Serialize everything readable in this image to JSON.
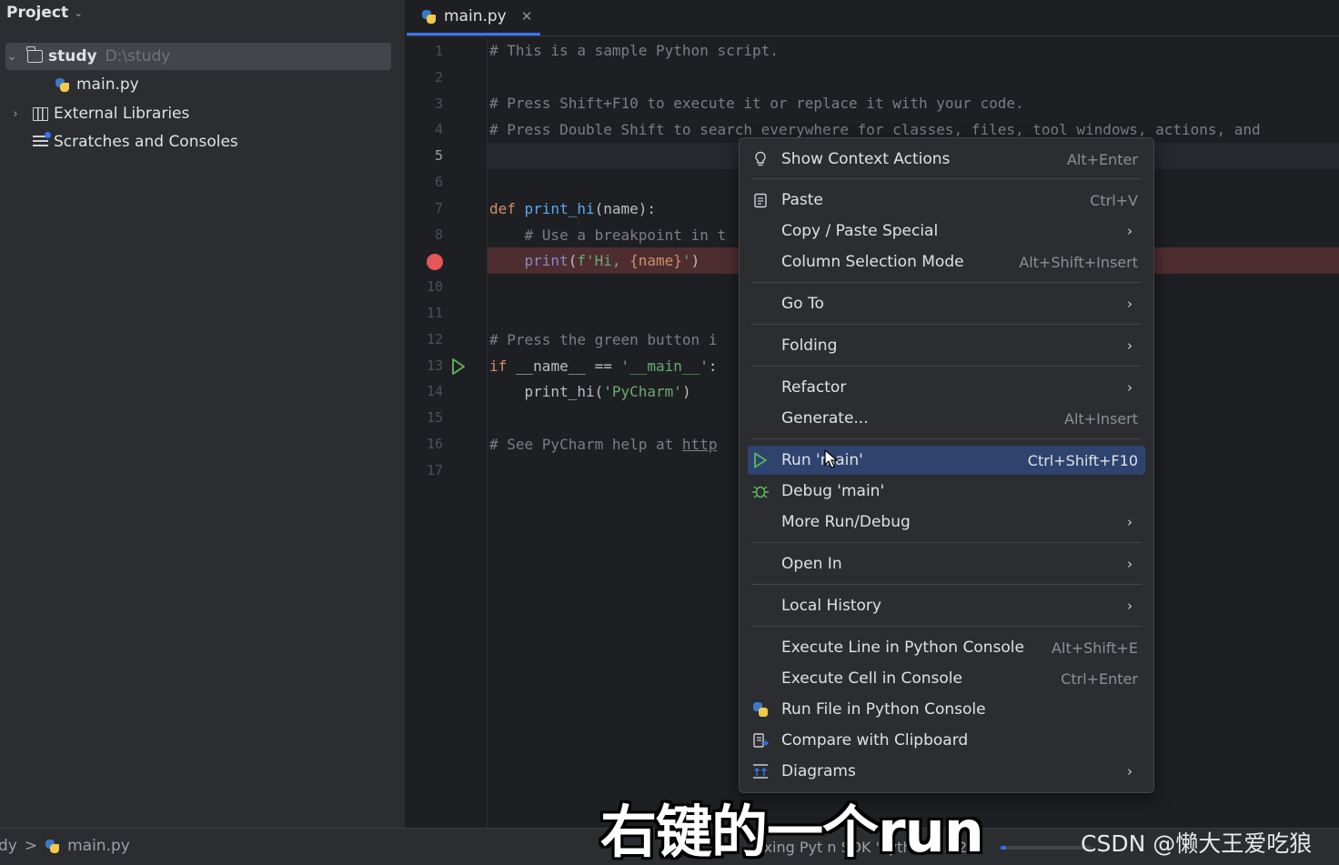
{
  "project_panel": {
    "title": "Project",
    "tree": {
      "root_name": "study",
      "root_path": "D:\\study",
      "file": "main.py",
      "external_libraries": "External Libraries",
      "scratches": "Scratches and Consoles"
    }
  },
  "editor": {
    "tab_name": "main.py",
    "current_line": 5,
    "breakpoint_line": 9,
    "run_marker_line": 13,
    "line_numbers": [
      "1",
      "2",
      "3",
      "4",
      "5",
      "6",
      "7",
      "8",
      "",
      "10",
      "11",
      "12",
      "13",
      "14",
      "15",
      "16",
      "17"
    ],
    "code": {
      "l1": "# This is a sample Python script.",
      "l3": "# Press Shift+F10 to execute it or replace it with your code.",
      "l4": "# Press Double Shift to search everywhere for classes, files, tool windows, actions, and",
      "l7_kw": "def ",
      "l7_fn": "print_hi",
      "l7_rest": "(name):",
      "l8": "    # Use a breakpoint in t",
      "l9_indent": "    ",
      "l9_fn": "print",
      "l9_paren": "(",
      "l9_str": "f'Hi, ",
      "l9_expr": "{name}",
      "l9_str_end": "'",
      "l9_close": ")",
      "l12": "# Press the green button i",
      "l13_kw": "if ",
      "l13_mid": "__name__ == ",
      "l13_str": "'__main__'",
      "l13_end": ":",
      "l14_pre": "    print_hi(",
      "l14_str": "'PyCharm'",
      "l14_end": ")",
      "l16_pre": "# See PyCharm help at ",
      "l16_link": "http"
    }
  },
  "context_menu": {
    "items": [
      {
        "label": "Show Context Actions",
        "shortcut": "Alt+Enter",
        "icon": "lightbulb-icon"
      },
      {
        "label": "Paste",
        "shortcut": "Ctrl+V",
        "icon": "clipboard-icon"
      },
      {
        "label": "Copy / Paste Special",
        "submenu": true
      },
      {
        "label": "Column Selection Mode",
        "shortcut": "Alt+Shift+Insert"
      },
      {
        "label": "Go To",
        "submenu": true
      },
      {
        "label": "Folding",
        "submenu": true
      },
      {
        "label": "Refactor",
        "submenu": true
      },
      {
        "label": "Generate...",
        "shortcut": "Alt+Insert"
      },
      {
        "label": "Run 'main'",
        "shortcut": "Ctrl+Shift+F10",
        "icon": "run-icon",
        "highlighted": true
      },
      {
        "label": "Debug 'main'",
        "icon": "bug-icon"
      },
      {
        "label": "More Run/Debug",
        "submenu": true
      },
      {
        "label": "Open In",
        "submenu": true
      },
      {
        "label": "Local History",
        "submenu": true
      },
      {
        "label": "Execute Line in Python Console",
        "shortcut": "Alt+Shift+E"
      },
      {
        "label": "Execute Cell in Console",
        "shortcut": "Ctrl+Enter"
      },
      {
        "label": "Run File in Python Console",
        "icon": "python-icon"
      },
      {
        "label": "Compare with Clipboard",
        "icon": "compare-icon"
      },
      {
        "label": "Diagrams",
        "submenu": true,
        "icon": "diagram-icon"
      }
    ],
    "submenu_arrow": "›"
  },
  "status_bar": {
    "breadcrumb_project": "dy",
    "breadcrumb_sep": ">",
    "breadcrumb_file": "main.py",
    "status_text": "exing Pyt   n SDK 'Python 3.12'",
    "progress": 0.06
  },
  "overlay": {
    "subtitle": "右键的一个run",
    "watermark": "CSDN @懒大王爱吃狼"
  },
  "colors": {
    "accent": "#3574f0",
    "breakpoint": "#e55757",
    "run_green": "#5fb85f",
    "menu_highlight": "#2e436e"
  }
}
